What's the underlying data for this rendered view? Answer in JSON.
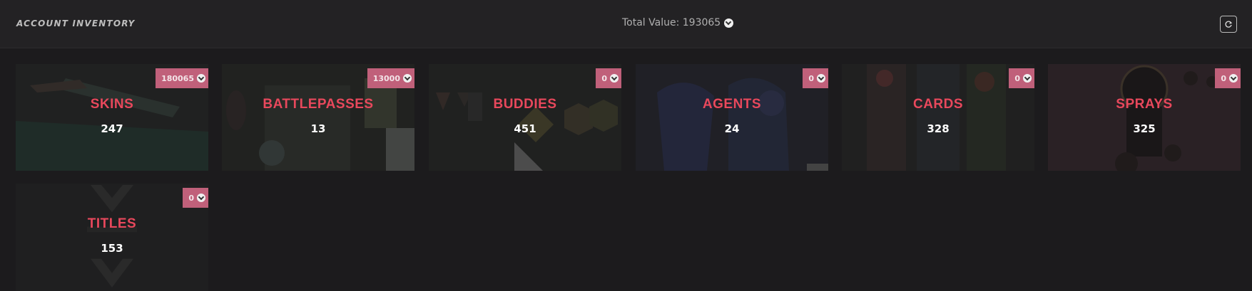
{
  "header": {
    "title": "ACCOUNT INVENTORY",
    "total_label": "Total Value: 193065",
    "refresh_icon": "refresh-icon"
  },
  "currency_icon": "valorant-points-icon",
  "colors": {
    "accent": "#e8485c",
    "badge": "#c0607a",
    "background": "#1c1b1d",
    "header": "#232224"
  },
  "cards": [
    {
      "name": "SKINS",
      "count": "247",
      "value": "180065"
    },
    {
      "name": "BATTLEPASSES",
      "count": "13",
      "value": "13000"
    },
    {
      "name": "BUDDIES",
      "count": "451",
      "value": "0"
    },
    {
      "name": "AGENTS",
      "count": "24",
      "value": "0"
    },
    {
      "name": "CARDS",
      "count": "328",
      "value": "0"
    },
    {
      "name": "SPRAYS",
      "count": "325",
      "value": "0"
    },
    {
      "name": "TITLES",
      "count": "153",
      "value": "0"
    }
  ]
}
